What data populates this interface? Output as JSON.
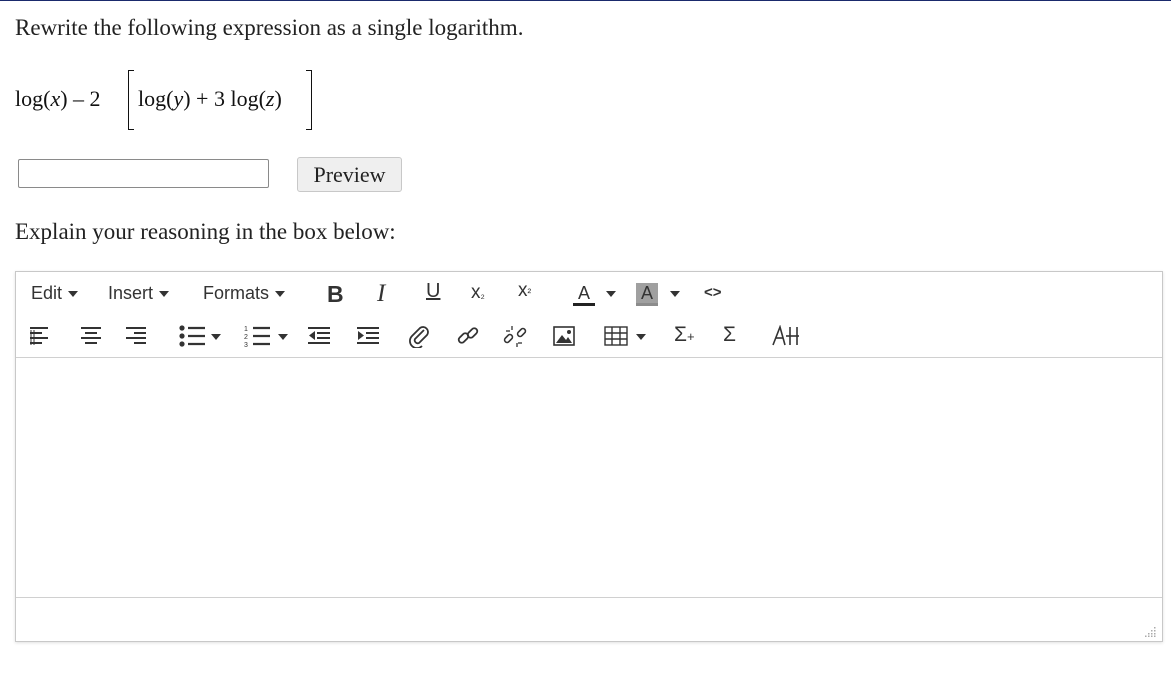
{
  "question": {
    "prompt": "Rewrite the following expression as a single logarithm.",
    "expression": {
      "first": "log(",
      "var_x": "x",
      "minus_two": ") – 2",
      "inner_log_y_open": "log(",
      "var_y": "y",
      "plus_three": ") + 3 log(",
      "var_z": "z",
      "close": ")"
    }
  },
  "answer": {
    "value": "",
    "placeholder": ""
  },
  "preview_button": {
    "label": "Preview"
  },
  "explain": {
    "label": "Explain your reasoning in the box below:"
  },
  "editor": {
    "menus": [
      {
        "label": "Edit"
      },
      {
        "label": "Insert"
      },
      {
        "label": "Formats"
      }
    ],
    "toolbar_row1": {
      "bold": "B",
      "italic": "I",
      "underline": "U",
      "subscript": "x",
      "subscript_mark": "₂",
      "superscript": "x",
      "superscript_mark": "²",
      "text_color": "A",
      "background_color": "A",
      "code": "<>"
    },
    "toolbar_row2": {
      "sigma_plus": "Σ",
      "plus_mark": "+",
      "sigma": "Σ"
    },
    "content": "",
    "icons": [
      "align-left-icon",
      "align-center-icon",
      "align-right-icon",
      "bullet-list-icon",
      "numbered-list-icon",
      "outdent-icon",
      "indent-icon",
      "attachment-icon",
      "link-icon",
      "unlink-icon",
      "image-icon",
      "table-icon",
      "insert-math-icon",
      "sigma-icon",
      "chemistry-icon",
      "resize-handle-icon"
    ]
  },
  "colors": {
    "text_color_bar": "#222222",
    "background_color_bar": "#8c8c8c",
    "border": "#c8c8c8",
    "button_bg": "#efefef"
  }
}
